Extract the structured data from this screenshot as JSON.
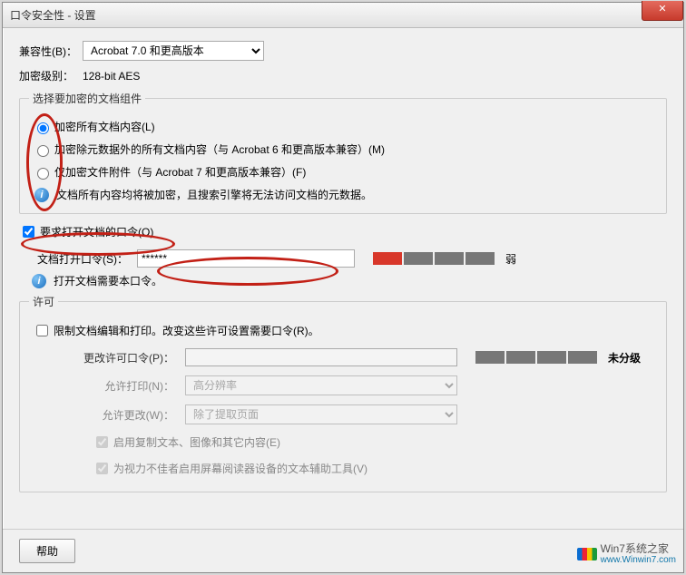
{
  "window": {
    "title": "口令安全性 - 设置",
    "close_glyph": "✕"
  },
  "compat": {
    "label": "兼容性(B)：",
    "value": "Acrobat 7.0 和更高版本"
  },
  "enc_level": {
    "label": "加密级别：",
    "value": "128-bit AES"
  },
  "components": {
    "legend": "选择要加密的文档组件",
    "opt_all": "加密所有文档内容(L)",
    "opt_except_meta": "加密除元数据外的所有文档内容（与 Acrobat 6 和更高版本兼容）(M)",
    "opt_attach_only": "仅加密文件附件（与 Acrobat 7 和更高版本兼容）(F)",
    "info": "文档所有内容均将被加密，且搜索引擎将无法访问文档的元数据。"
  },
  "open_pw": {
    "require_label": "要求打开文档的口令(O)",
    "field_label": "文档打开口令(S)：",
    "value": "******",
    "strength_label": "弱",
    "info": "打开文档需要本口令。"
  },
  "perms": {
    "legend": "许可",
    "restrict_label": "限制文档编辑和打印。改变这些许可设置需要口令(R)。",
    "change_pw_label": "更改许可口令(P)：",
    "change_pw_value": "",
    "strength_label": "未分级",
    "allow_print_label": "允许打印(N)：",
    "allow_print_value": "高分辨率",
    "allow_change_label": "允许更改(W)：",
    "allow_change_value": "除了提取页面",
    "copy_label": "启用复制文本、图像和其它内容(E)",
    "screenreader_label": "为视力不佳者启用屏幕阅读器设备的文本辅助工具(V)"
  },
  "footer": {
    "help": "帮助"
  },
  "watermark": {
    "text1": "Win7系统之家",
    "text2": "www.Winwin7.com"
  },
  "info_glyph": "i"
}
